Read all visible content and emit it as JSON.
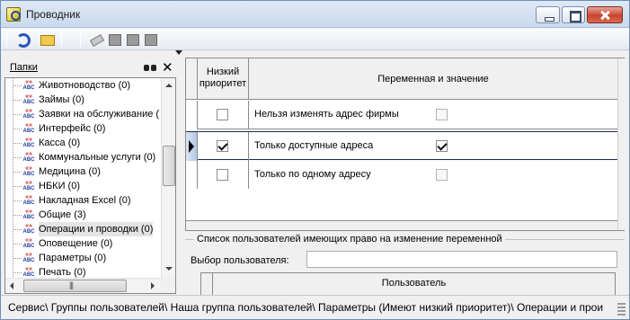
{
  "window": {
    "title": "Проводник"
  },
  "left_panel": {
    "title": "Папки",
    "tree_items": [
      {
        "label": "Животноводство (0)"
      },
      {
        "label": "Займы (0)"
      },
      {
        "label": "Заявки на обслуживание ("
      },
      {
        "label": "Интерфейс (0)"
      },
      {
        "label": "Касса (0)"
      },
      {
        "label": "Коммунальные услуги (0)"
      },
      {
        "label": "Медицина (0)"
      },
      {
        "label": "НБКИ (0)"
      },
      {
        "label": "Накладная Excel (0)"
      },
      {
        "label": "Общие (3)"
      },
      {
        "label": "Операции и проводки (0)",
        "selected": true
      },
      {
        "label": "Оповещение (0)"
      },
      {
        "label": "Параметры (0)"
      },
      {
        "label": "Печать (0)"
      }
    ],
    "icon_text": {
      "top": "«»",
      "bottom": "ABC"
    }
  },
  "grid": {
    "col1_header_line1": "Низкий",
    "col1_header_line2": "приоритет",
    "col2_header": "Переменная и значение",
    "rows": [
      {
        "low_priority": false,
        "name": "Нельзя изменять адрес фирмы",
        "value": false,
        "current": false
      },
      {
        "low_priority": true,
        "name": "Только доступные адреса",
        "value": true,
        "current": true
      },
      {
        "low_priority": false,
        "name": "Только по одному адресу",
        "value": false,
        "current": false
      }
    ]
  },
  "users_group": {
    "title": "Список пользователей имеющих право на изменение переменной",
    "select_label": "Выбор пользователя:",
    "select_value": "",
    "column_header": "Пользователь"
  },
  "statusbar": {
    "path": "Сервис\\ Группы пользователей\\ Наша группа пользователей\\ Параметры (Имеют низкий приоритет)\\ Операции и прои"
  }
}
